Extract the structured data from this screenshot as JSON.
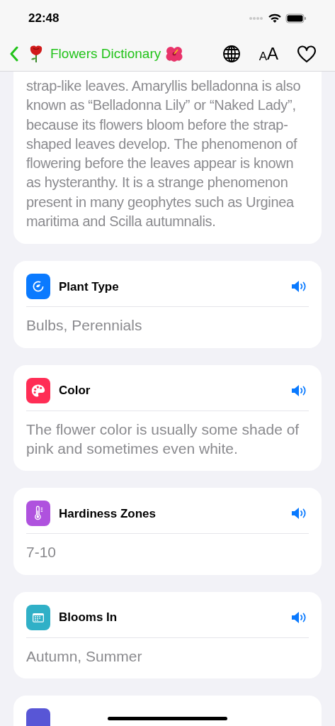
{
  "status_bar": {
    "time": "22:48"
  },
  "nav": {
    "title": "Flowers Dictionary",
    "text_size_letters": [
      "A",
      "A"
    ]
  },
  "description": {
    "text": "strap-like leaves. Amaryllis belladonna is also known as “Belladonna Lily” or “Naked Lady”, because its flowers bloom before the strap-shaped leaves develop. The phenomenon of flowering before the leaves appear is known as hysteranthy. It is a strange phenomenon present in many geophytes such as Urginea maritima and Scilla autumnalis."
  },
  "fields": [
    {
      "title": "Plant Type",
      "value": "Bulbs, Perennials",
      "color": "#0a7aff"
    },
    {
      "title": "Color",
      "value": "The flower color is usually some shade of pink and sometimes even white.",
      "color": "#ff2d55"
    },
    {
      "title": "Hardiness Zones",
      "value": "7-10",
      "color": "#af52de"
    },
    {
      "title": "Blooms In",
      "value": "Autumn, Summer",
      "color": "#30b0c7"
    },
    {
      "color": "#5856d6"
    }
  ]
}
